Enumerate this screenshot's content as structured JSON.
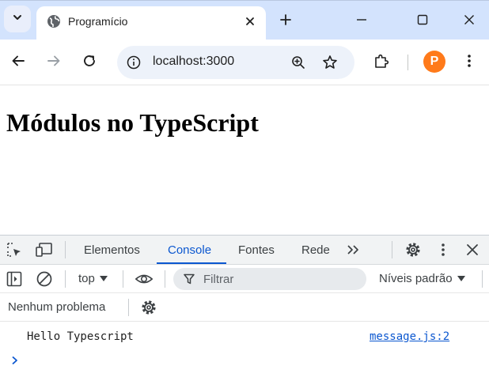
{
  "browser": {
    "tab": {
      "title": "Programício",
      "icon": "globe-icon"
    },
    "address": {
      "url": "localhost:3000"
    },
    "profile": {
      "avatar_letter": "P"
    }
  },
  "page": {
    "heading": "Módulos no TypeScript"
  },
  "devtools": {
    "tabs": [
      {
        "label": "Elementos",
        "active": false
      },
      {
        "label": "Console",
        "active": true
      },
      {
        "label": "Fontes",
        "active": false
      },
      {
        "label": "Rede",
        "active": false
      }
    ],
    "toolbar": {
      "context": "top",
      "filter_placeholder": "Filtrar",
      "levels": "Níveis padrão"
    },
    "issues": "Nenhum problema",
    "console": {
      "messages": [
        {
          "text": "Hello Typescript",
          "source": "message.js:2"
        }
      ]
    }
  },
  "colors": {
    "tabstrip": "#d3e3fd",
    "accent": "#0b57d0",
    "avatar": "#ff7a1a"
  }
}
